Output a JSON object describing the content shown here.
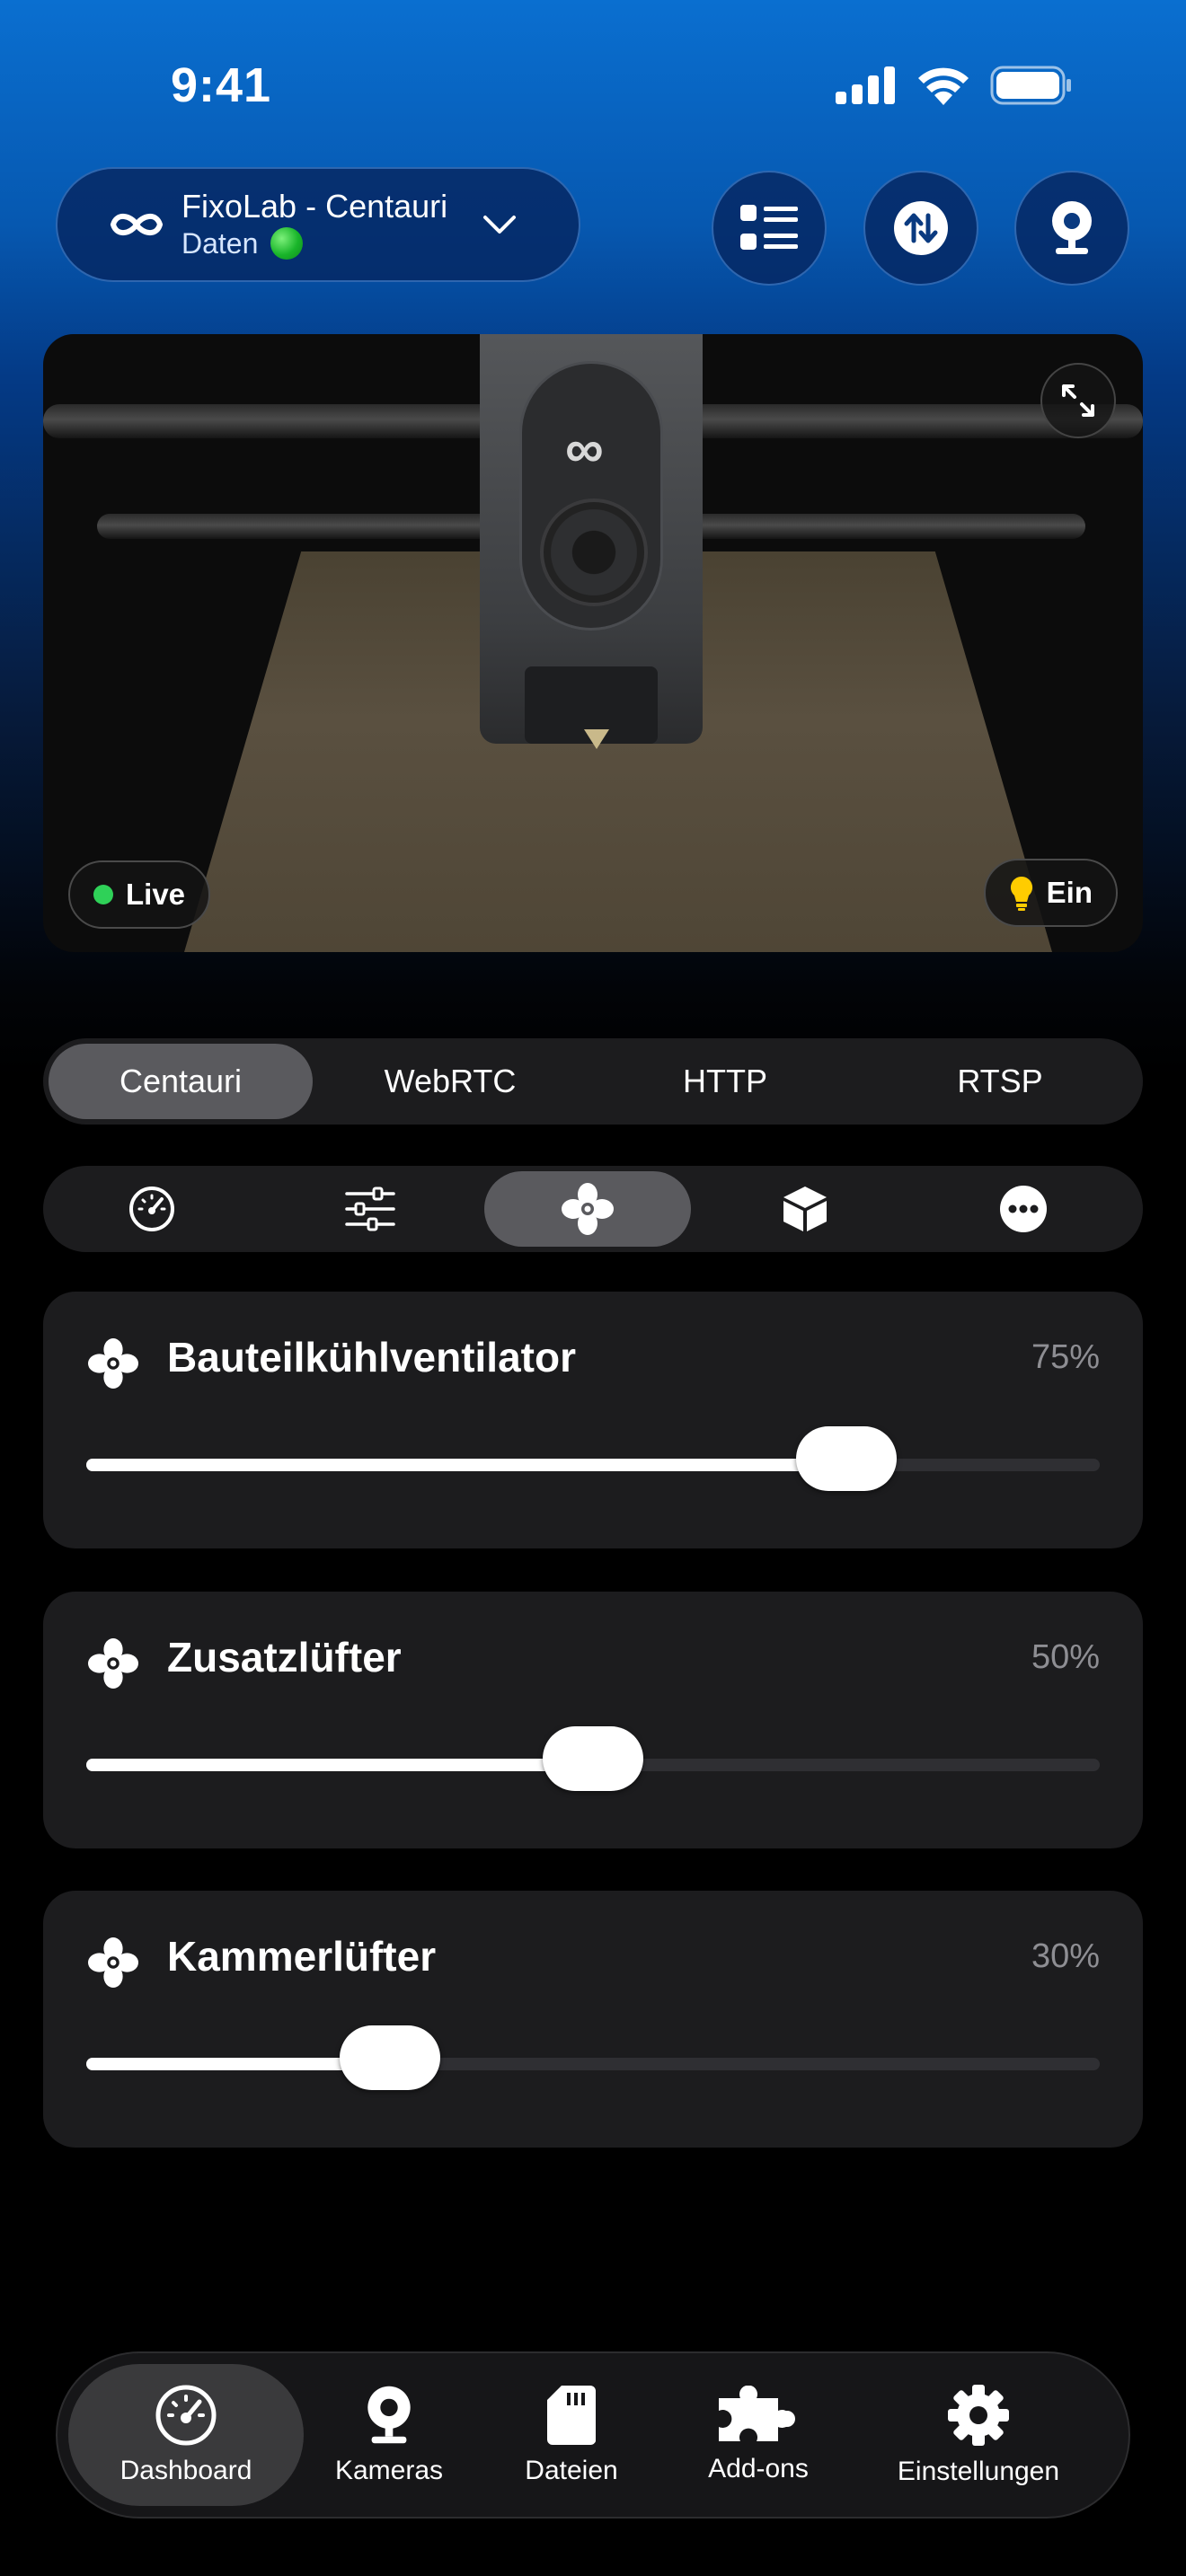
{
  "status_bar": {
    "time": "9:41"
  },
  "header": {
    "printer_name": "FixoLab - Centauri",
    "printer_status": "Daten",
    "buttons": [
      "list-icon",
      "transfer-icon",
      "webcam-icon"
    ]
  },
  "camera": {
    "live_label": "Live",
    "light_label": "Ein"
  },
  "source_tabs": {
    "selected": "Centauri",
    "items": [
      "Centauri",
      "WebRTC",
      "HTTP",
      "RTSP"
    ]
  },
  "icon_tabs": {
    "selected": "fan-icon",
    "items": [
      "gauge-icon",
      "sliders-icon",
      "fan-icon",
      "box-icon",
      "more-icon"
    ]
  },
  "fans": [
    {
      "name": "Bauteilkühlventilator",
      "value_label": "75%",
      "value": 75
    },
    {
      "name": "Zusatzlüfter",
      "value_label": "50%",
      "value": 50
    },
    {
      "name": "Kammerlüfter",
      "value_label": "30%",
      "value": 30
    }
  ],
  "tab_bar": {
    "selected": "Dashboard",
    "items": [
      {
        "label": "Dashboard",
        "icon": "speedometer-icon"
      },
      {
        "label": "Kameras",
        "icon": "webcam-icon"
      },
      {
        "label": "Dateien",
        "icon": "sd-card-icon"
      },
      {
        "label": "Add-ons",
        "icon": "puzzle-icon"
      },
      {
        "label": "Einstellungen",
        "icon": "gear-icon"
      }
    ]
  },
  "colors": {
    "live_dot": "#2fd158",
    "status_dot": "#19b52a",
    "active_tab": "#5a5a5e",
    "card_bg": "#1c1c1e"
  }
}
